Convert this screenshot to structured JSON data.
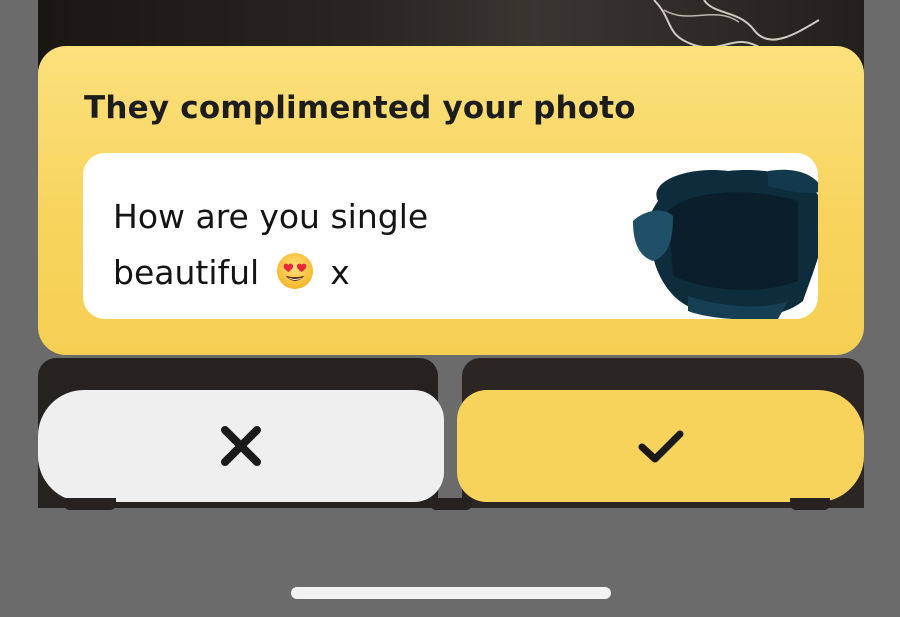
{
  "card": {
    "title": "They complimented your photo",
    "message_line1": "How are you single",
    "message_line2": "beautiful",
    "message_emoji": "heart-eyes-emoji",
    "message_suffix": "x",
    "redaction": "blue-scribble-redaction"
  },
  "actions": {
    "reject_icon": "close-icon",
    "accept_icon": "check-icon"
  },
  "colors": {
    "card_yellow": "#f8d45e",
    "accept_yellow": "#f8d35b",
    "reject_gray": "#efefef",
    "backdrop": "#6b6b6b",
    "text_dark": "#1d1d1d"
  }
}
